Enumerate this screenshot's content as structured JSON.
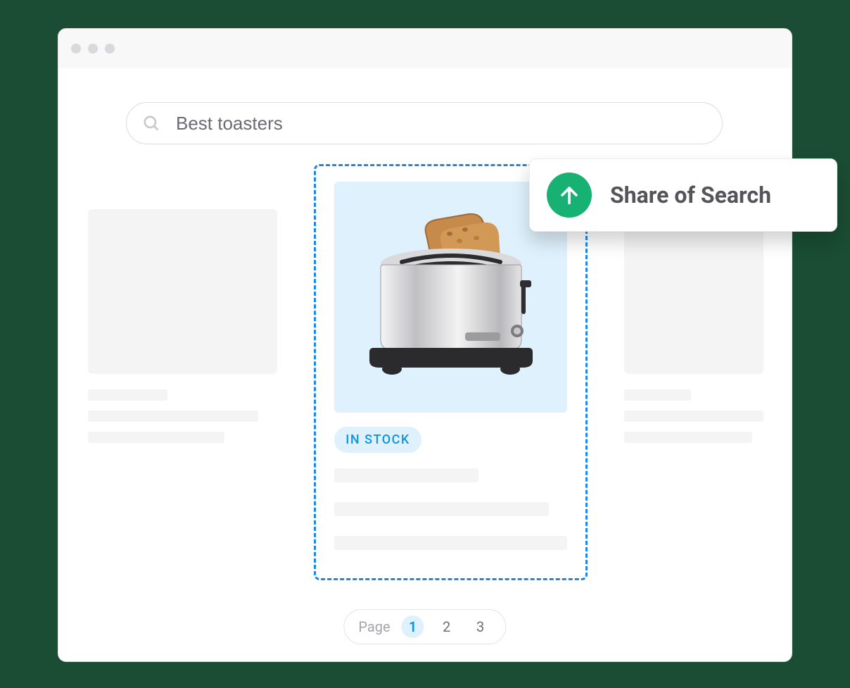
{
  "search": {
    "query": "Best toasters",
    "placeholder": "Search"
  },
  "featured": {
    "stock_badge": "IN STOCK",
    "product_name": "toaster"
  },
  "popup": {
    "title": "Share of Search",
    "direction": "up"
  },
  "pagination": {
    "label": "Page",
    "current": "1",
    "pages": [
      "1",
      "2",
      "3"
    ]
  },
  "colors": {
    "accent_blue": "#1b89ec",
    "badge_bg": "#dff1fc",
    "badge_text": "#0f93e5",
    "up_green": "#17b173"
  }
}
